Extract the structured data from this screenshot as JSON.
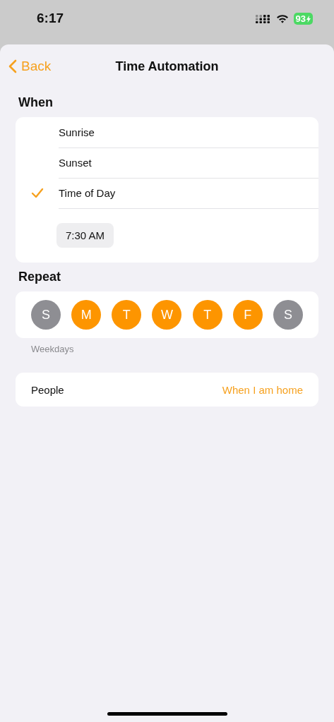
{
  "status_bar": {
    "time": "6:17",
    "battery": "93"
  },
  "nav": {
    "back": "Back",
    "title": "Time Automation"
  },
  "when": {
    "header": "When",
    "options": [
      {
        "label": "Sunrise",
        "selected": false
      },
      {
        "label": "Sunset",
        "selected": false
      },
      {
        "label": "Time of Day",
        "selected": true
      }
    ],
    "time": "7:30 AM"
  },
  "repeat": {
    "header": "Repeat",
    "days": [
      {
        "label": "S",
        "selected": false
      },
      {
        "label": "M",
        "selected": true
      },
      {
        "label": "T",
        "selected": true
      },
      {
        "label": "W",
        "selected": true
      },
      {
        "label": "T",
        "selected": true
      },
      {
        "label": "F",
        "selected": true
      },
      {
        "label": "S",
        "selected": false
      }
    ],
    "footer": "Weekdays"
  },
  "people": {
    "label": "People",
    "value": "When I am home"
  }
}
